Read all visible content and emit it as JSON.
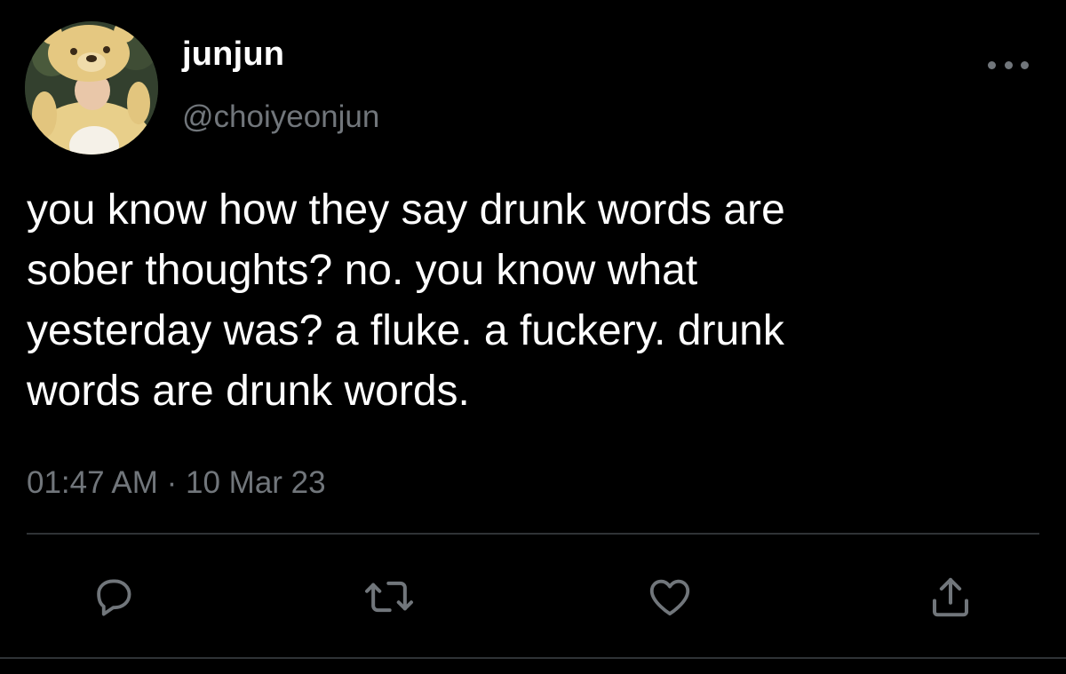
{
  "user": {
    "display_name": "junjun",
    "handle": "@choiyeonjun"
  },
  "tweet": {
    "text": "you know how they say drunk words are\nsober thoughts? no. you know what\nyesterday was? a fluke. a fuckery. drunk\nwords are drunk words.",
    "time": "01:47 AM",
    "separator": "·",
    "date": "10 Mar 23"
  },
  "icons": {
    "more": "more-horizontal-icon",
    "reply": "reply-icon",
    "retweet": "retweet-icon",
    "like": "heart-icon",
    "share": "share-icon"
  },
  "colors": {
    "background": "#000000",
    "text": "#ffffff",
    "muted": "#71767b",
    "divider": "#2f3336"
  }
}
